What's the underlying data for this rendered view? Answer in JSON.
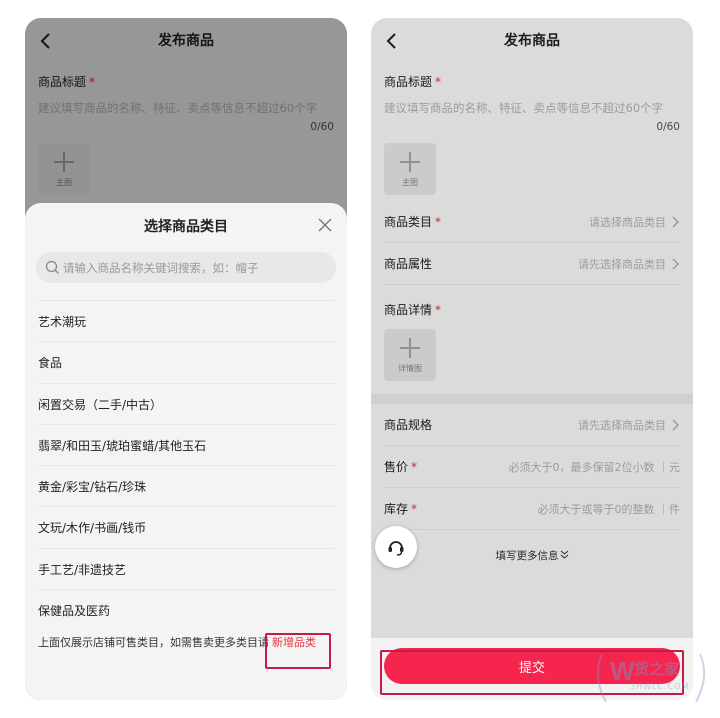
{
  "left_screen": {
    "header": {
      "title": "发布商品"
    },
    "title_field": {
      "label": "商品标题",
      "required_mark": "*",
      "placeholder": "建议填写商品的名称、特征、卖点等信息不超过60个字",
      "counter": "0/60"
    },
    "main_image": {
      "label": "主图"
    },
    "category_sheet": {
      "title": "选择商品类目",
      "search_placeholder": "请输入商品名称关键词搜索，如：帽子",
      "categories": [
        "艺术潮玩",
        "食品",
        "闲置交易（二手/中古）",
        "翡翠/和田玉/琥珀蜜蜡/其他玉石",
        "黄金/彩宝/钻石/珍珠",
        "文玩/木作/书画/钱币",
        "手工艺/非遗技艺",
        "保健品及医药"
      ],
      "footer_text": "上面仅展示店铺可售类目，如需售卖更多类目请",
      "footer_link": "新增品类"
    }
  },
  "right_screen": {
    "header": {
      "title": "发布商品"
    },
    "title_field": {
      "label": "商品标题",
      "required_mark": "*",
      "placeholder": "建议填写商品的名称、特征、卖点等信息不超过60个字",
      "counter": "0/60"
    },
    "main_image": {
      "label": "主图"
    },
    "category_row": {
      "label": "商品类目",
      "required_mark": "*",
      "value": "请选择商品类目"
    },
    "attribute_row": {
      "label": "商品属性",
      "value": "请先选择商品类目"
    },
    "detail_field": {
      "label": "商品详情",
      "required_mark": "*"
    },
    "detail_image": {
      "label": "详情图"
    },
    "spec_row": {
      "label": "商品规格",
      "value": "请先选择商品类目"
    },
    "price_row": {
      "label": "售价",
      "required_mark": "*",
      "value": "必须大于0，最多保留2位小数 ｜元"
    },
    "stock_row": {
      "label": "库存",
      "required_mark": "*",
      "value": "必须大于或等于0的整数 ｜件"
    },
    "more_info": "填写更多信息",
    "submit_label": "提交"
  },
  "watermark": {
    "text": "货之家",
    "sub": "3HWLC.COM"
  },
  "colors": {
    "accent": "#f5254e",
    "highlight_border": "#c41c48",
    "required": "#e33333",
    "link": "#e5373f"
  },
  "icons": [
    "back-icon",
    "close-icon",
    "search-icon",
    "plus-icon",
    "chevron-right-icon",
    "headset-icon",
    "chevron-double-down-icon"
  ]
}
